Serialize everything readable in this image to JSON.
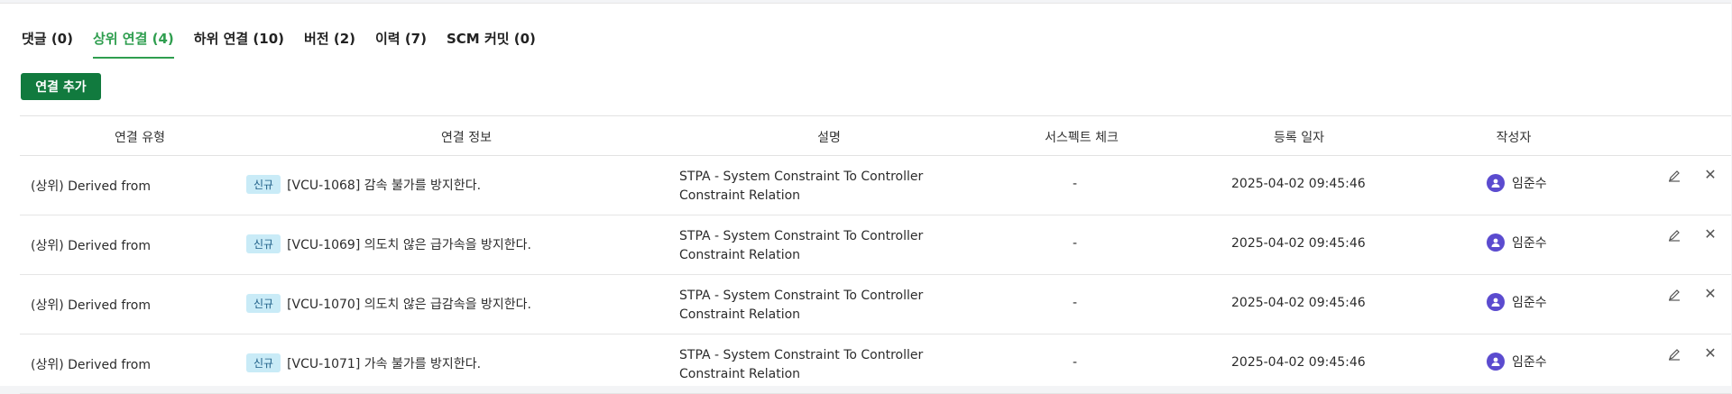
{
  "tabs": [
    {
      "label": "댓글 (0)",
      "active": false
    },
    {
      "label": "상위 연결 (4)",
      "active": true
    },
    {
      "label": "하위 연결 (10)",
      "active": false
    },
    {
      "label": "버전 (2)",
      "active": false
    },
    {
      "label": "이력 (7)",
      "active": false
    },
    {
      "label": "SCM 커밋 (0)",
      "active": false
    }
  ],
  "toolbar": {
    "add_label": "연결 추가"
  },
  "columns": [
    "연결 유형",
    "연결 정보",
    "설명",
    "서스펙트 체크",
    "등록 일자",
    "작성자"
  ],
  "rows": [
    {
      "type": "(상위) Derived from",
      "badge": "신규",
      "info": "[VCU-1068] 감속 불가를 방지한다.",
      "desc": "STPA - System Constraint To Controller Constraint Relation",
      "check": "-",
      "date": "2025-04-02 09:45:46",
      "author": "임준수"
    },
    {
      "type": "(상위) Derived from",
      "badge": "신규",
      "info": "[VCU-1069] 의도치 않은 급가속을 방지한다.",
      "desc": "STPA - System Constraint To Controller Constraint Relation",
      "check": "-",
      "date": "2025-04-02 09:45:46",
      "author": "임준수"
    },
    {
      "type": "(상위) Derived from",
      "badge": "신규",
      "info": "[VCU-1070] 의도치 않은 급감속을 방지한다.",
      "desc": "STPA - System Constraint To Controller Constraint Relation",
      "check": "-",
      "date": "2025-04-02 09:45:46",
      "author": "임준수"
    },
    {
      "type": "(상위) Derived from",
      "badge": "신규",
      "info": "[VCU-1071] 가속 불가를 방지한다.",
      "desc": "STPA - System Constraint To Controller Constraint Relation",
      "check": "-",
      "date": "2025-04-02 09:45:46",
      "author": "임준수"
    }
  ],
  "icons": {
    "edit": "pencil-icon",
    "delete": "close-icon",
    "avatar": "user-icon"
  },
  "colors": {
    "accent": "#2f9e4f",
    "button": "#117a3e",
    "badge_bg": "#c9ebf7",
    "avatar": "#5b4bcf"
  }
}
